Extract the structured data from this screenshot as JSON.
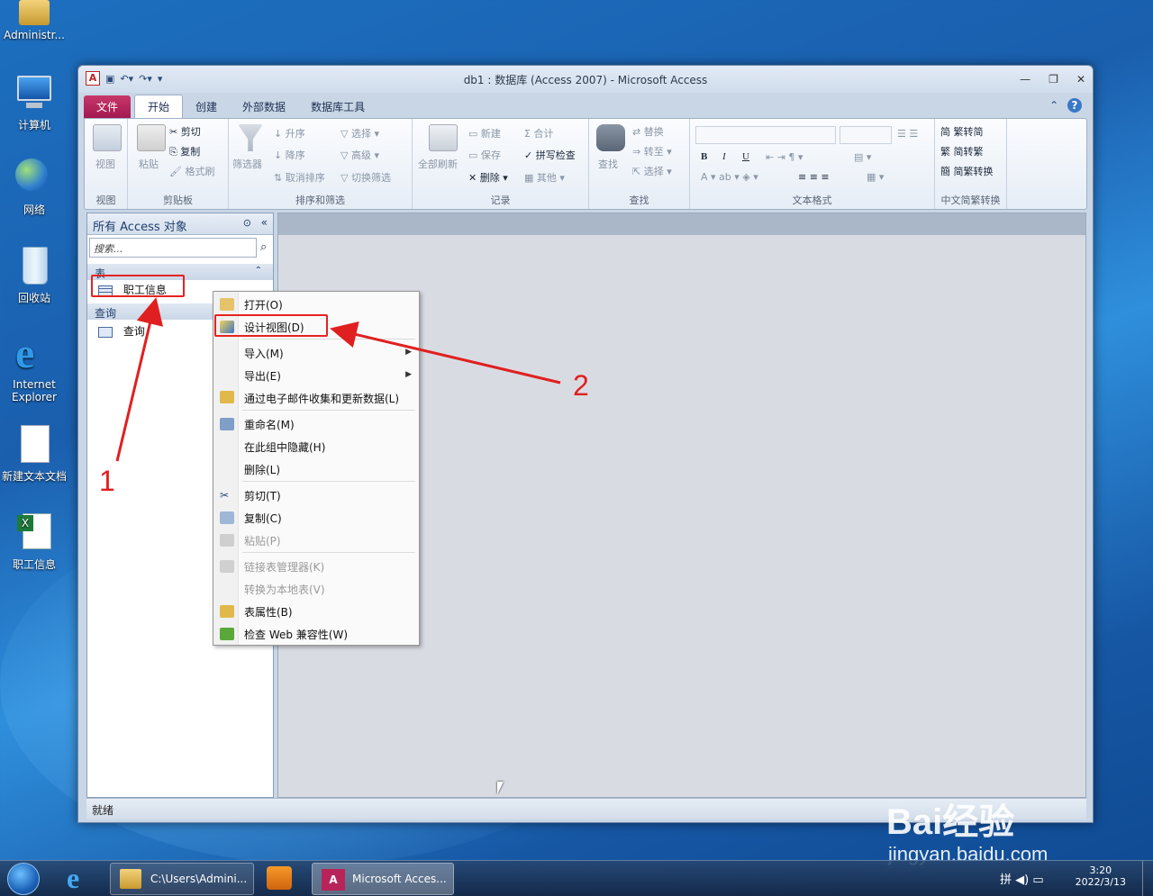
{
  "desktop": {
    "icons": [
      {
        "label": "Administr..."
      },
      {
        "label": "计算机"
      },
      {
        "label": "网络"
      },
      {
        "label": "回收站"
      },
      {
        "label": "Internet Explorer"
      },
      {
        "label": "新建文本文档"
      },
      {
        "label": "职工信息"
      }
    ]
  },
  "window": {
    "title": "db1 : 数据库 (Access 2007)  -  Microsoft Access",
    "tabs": [
      "文件",
      "开始",
      "创建",
      "外部数据",
      "数据库工具"
    ],
    "ribbon": {
      "view": {
        "label": "视图",
        "group": "视图"
      },
      "clipboard": {
        "paste": "粘贴",
        "cut": "剪切",
        "copy": "复制",
        "format": "格式刷",
        "group": "剪贴板"
      },
      "sort": {
        "filter": "筛选器",
        "asc": "升序",
        "desc": "降序",
        "clear": "取消排序",
        "select": "选择",
        "advanced": "高级",
        "toggle": "切换筛选",
        "group": "排序和筛选"
      },
      "records": {
        "refresh": "全部刷新",
        "new": "新建",
        "save": "保存",
        "delete": "删除",
        "total": "合计",
        "spell": "拼写检查",
        "other": "其他",
        "group": "记录"
      },
      "find": {
        "find": "查找",
        "replace": "替换",
        "goto": "转至",
        "select": "选择",
        "group": "查找"
      },
      "textformat": {
        "bold": "B",
        "italic": "I",
        "underline": "U",
        "group": "文本格式"
      },
      "chinese": {
        "t2s": "繁转简",
        "s2t": "简转繁",
        "convert": "简繁转换",
        "group": "中文简繁转换"
      }
    },
    "nav": {
      "header": "所有 Access 对象",
      "search_placeholder": "搜索...",
      "section_tables": "表",
      "table_item": "职工信息",
      "section_queries": "查询",
      "query_item": "查询"
    },
    "status": "就绪"
  },
  "context_menu": {
    "items": [
      {
        "label": "打开(O)",
        "enabled": true
      },
      {
        "label": "设计视图(D)",
        "enabled": true
      },
      {
        "label": "导入(M)",
        "enabled": true
      },
      {
        "label": "导出(E)",
        "enabled": true
      },
      {
        "label": "通过电子邮件收集和更新数据(L)",
        "enabled": true
      },
      {
        "label": "重命名(M)",
        "enabled": true
      },
      {
        "label": "在此组中隐藏(H)",
        "enabled": true
      },
      {
        "label": "删除(L)",
        "enabled": true
      },
      {
        "label": "剪切(T)",
        "enabled": true
      },
      {
        "label": "复制(C)",
        "enabled": true
      },
      {
        "label": "粘贴(P)",
        "enabled": false
      },
      {
        "label": "链接表管理器(K)",
        "enabled": false
      },
      {
        "label": "转换为本地表(V)",
        "enabled": false
      },
      {
        "label": "表属性(B)",
        "enabled": true
      },
      {
        "label": "检查 Web 兼容性(W)",
        "enabled": true
      }
    ]
  },
  "annotations": {
    "one": "1",
    "two": "2"
  },
  "taskbar": {
    "explorer": "C:\\Users\\Admini...",
    "access": "Microsoft Acces...",
    "time": "3:20",
    "date": "2022/3/13"
  },
  "watermark": {
    "brand": "Bai经验",
    "url": "jingyan.baidu.com"
  },
  "colors": {
    "file_tab": "#b8245a",
    "annotation": "#e02020",
    "desktop": "#1a5fae"
  }
}
